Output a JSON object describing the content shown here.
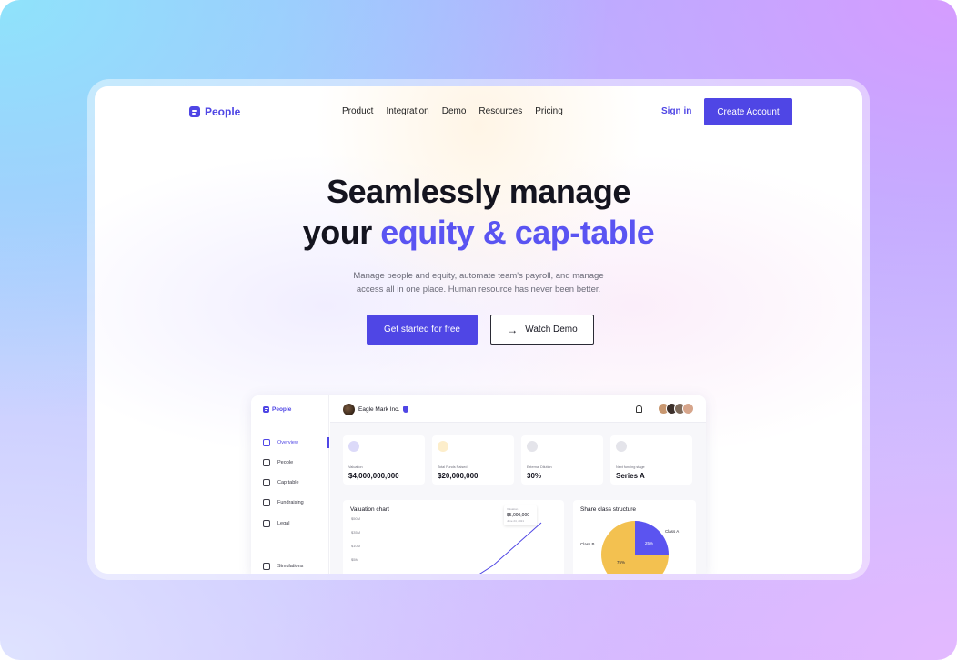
{
  "brand": {
    "name": "People",
    "color": "#4f46e5",
    "icon": "document-lines-icon"
  },
  "nav": {
    "items": [
      "Product",
      "Integration",
      "Demo",
      "Resources",
      "Pricing"
    ]
  },
  "auth": {
    "sign_in": "Sign in",
    "create_account": "Create Account"
  },
  "hero": {
    "line1": "Seamlessly manage",
    "line2_prefix": "your",
    "line2_accent": "equity & cap-table",
    "sub1": "Manage people and equity, automate team's payroll, and manage",
    "sub2": "access all in one place. Human resource has never been better.",
    "cta_primary": "Get started for free",
    "cta_secondary": "Watch Demo",
    "cta_secondary_icon": "arrow-right-icon"
  },
  "dashboard": {
    "brand": "People",
    "company": "Eagle Mark Inc.",
    "sidebar": [
      {
        "label": "Overview",
        "icon": "cube-icon",
        "active": true
      },
      {
        "label": "People",
        "icon": "people-icon",
        "active": false
      },
      {
        "label": "Cap table",
        "icon": "table-icon",
        "active": false
      },
      {
        "label": "Fundraising",
        "icon": "money-icon",
        "active": false
      },
      {
        "label": "Legal",
        "icon": "document-icon",
        "active": false
      },
      {
        "label": "Simulations",
        "icon": "simulation-icon",
        "active": false
      }
    ],
    "cards": [
      {
        "label": "Valuation",
        "value": "$4,000,000,000",
        "icon_color": "#dcdaf9"
      },
      {
        "label": "Total Funds Raised",
        "value": "$20,000,000",
        "icon_color": "#fdeecb"
      },
      {
        "label": "External Dilution",
        "value": "30%",
        "icon_color": "#e4e4ea"
      },
      {
        "label": "Next funding stage",
        "value": "Series A",
        "icon_color": "#e4e4ea"
      }
    ],
    "valuation_chart": {
      "title": "Valuation chart",
      "ticks": [
        "$50M",
        "$35M",
        "$10M",
        "$5M"
      ],
      "tooltip_label": "Valuation",
      "tooltip_value": "$5,000,000",
      "tooltip_date": "June 24, 2021"
    },
    "share_class": {
      "title": "Share class structure",
      "class_a": "Class A",
      "class_b": "Class B",
      "pct_a": "25%",
      "pct_b": "75%",
      "color_a": "#5b54f0",
      "color_b": "#f3c150"
    }
  },
  "chart_data": {
    "type": "pie",
    "title": "Share class structure",
    "categories": [
      "Class A",
      "Class B"
    ],
    "values": [
      25,
      75
    ]
  }
}
